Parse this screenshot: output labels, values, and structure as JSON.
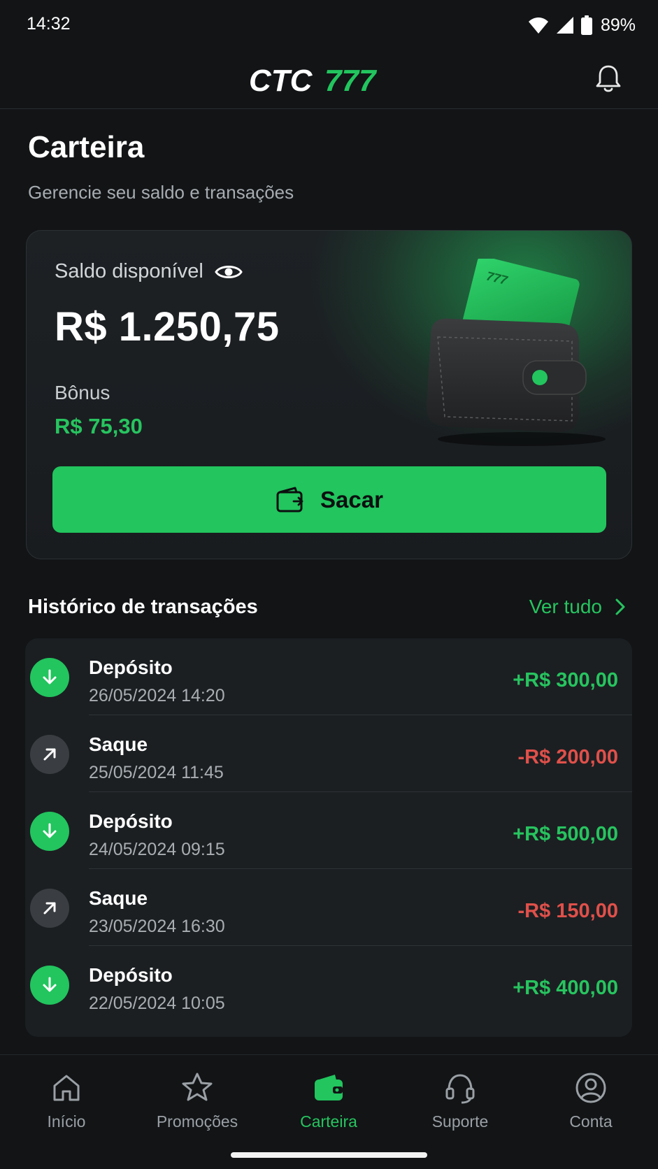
{
  "status_bar": {
    "time": "14:32",
    "battery": "89%"
  },
  "header": {
    "logo_text_left": "CTC",
    "logo_text_right": "777"
  },
  "page": {
    "title": "Carteira",
    "subtitle": "Gerencie seu saldo e transações"
  },
  "balance_card": {
    "label": "Saldo disponível",
    "value": "R$ 1.250,75",
    "bonus_label": "Bônus",
    "bonus_value": "R$ 75,30",
    "card_art_text": "777",
    "withdraw_label": "Sacar"
  },
  "history": {
    "title": "Histórico de transações",
    "see_all": "Ver tudo",
    "items": [
      {
        "name": "Depósito",
        "date": "26/05/2024 14:20",
        "amount": "+R$ 300,00",
        "type": "in"
      },
      {
        "name": "Saque",
        "date": "25/05/2024 11:45",
        "amount": "-R$ 200,00",
        "type": "out"
      },
      {
        "name": "Depósito",
        "date": "24/05/2024 09:15",
        "amount": "+R$ 500,00",
        "type": "in"
      },
      {
        "name": "Saque",
        "date": "23/05/2024 16:30",
        "amount": "-R$ 150,00",
        "type": "out"
      },
      {
        "name": "Depósito",
        "date": "22/05/2024 10:05",
        "amount": "+R$ 400,00",
        "type": "in"
      }
    ]
  },
  "nav": {
    "items": [
      {
        "label": "Início",
        "icon": "home-icon"
      },
      {
        "label": "Promoções",
        "icon": "star-icon"
      },
      {
        "label": "Carteira",
        "icon": "wallet-icon",
        "active": true
      },
      {
        "label": "Suporte",
        "icon": "headset-icon"
      },
      {
        "label": "Conta",
        "icon": "user-circle-icon"
      }
    ]
  },
  "colors": {
    "accent": "#22c55e",
    "positive": "#27c45f",
    "negative": "#e0504a",
    "background": "#121416",
    "surface": "#1b1f22"
  }
}
